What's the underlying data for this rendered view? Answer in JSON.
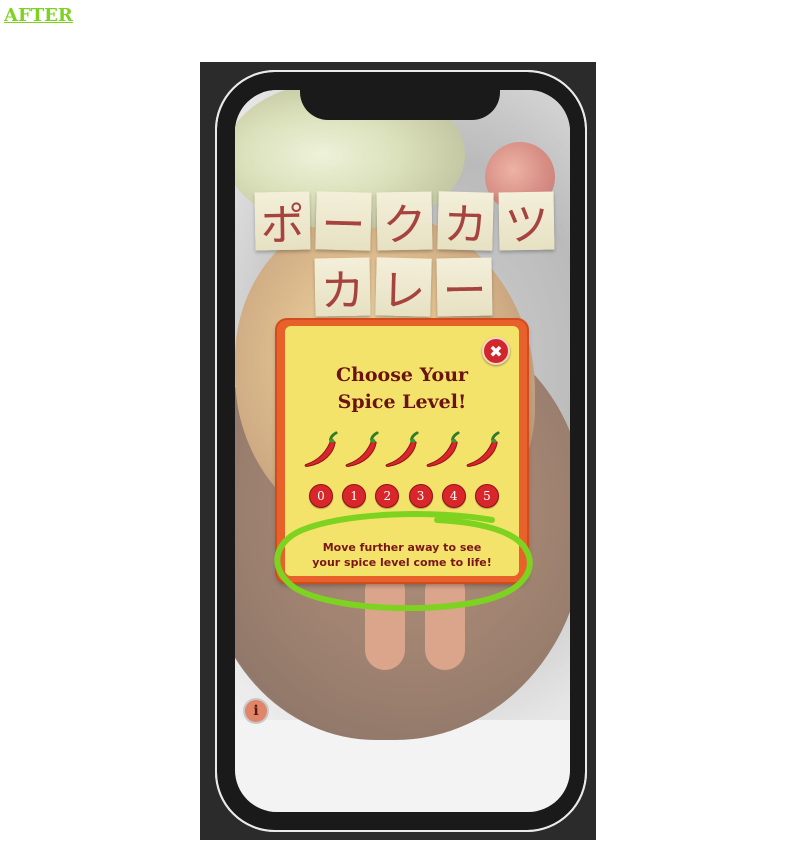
{
  "header": {
    "label": "AFTER"
  },
  "title": {
    "row1": [
      "ポ",
      "ー",
      "ク",
      "カ",
      "ツ"
    ],
    "row2": [
      "カ",
      "レ",
      "ー"
    ]
  },
  "popup": {
    "close_icon": "close-icon",
    "title_line1": "Choose Your",
    "title_line2": "Spice Level!",
    "pepper_icon": "chili-pepper-icon",
    "pepper_count": 5,
    "levels": [
      "0",
      "1",
      "2",
      "3",
      "4",
      "5"
    ],
    "message_line1": "Move further away to see",
    "message_line2": "your spice level come to life!"
  },
  "info_button": {
    "label": "i"
  },
  "colors": {
    "after_label": "#7ed321",
    "annotation_circle": "#7ed321",
    "popup_bg": "#f4e36a",
    "popup_border": "#e8612a",
    "level_button": "#d9262b",
    "title_text": "#a7433f"
  }
}
